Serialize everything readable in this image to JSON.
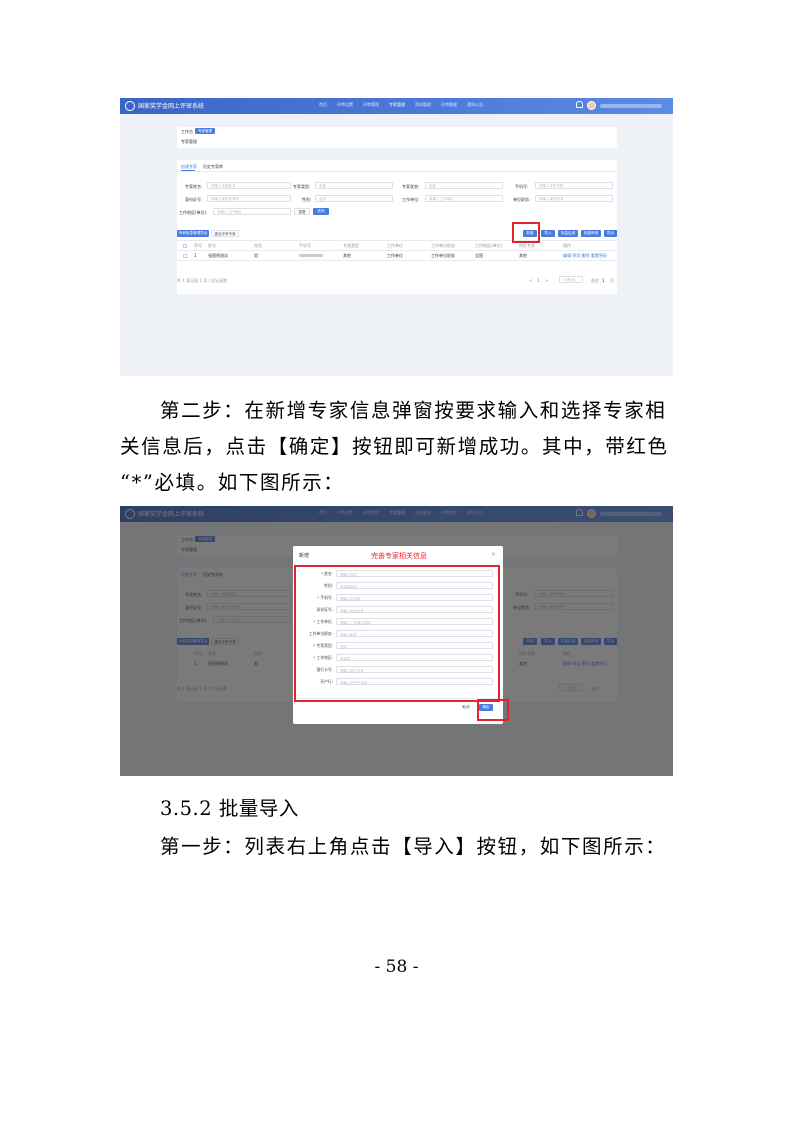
{
  "system_name": "国家奖学金网上评审系统",
  "nav_items": [
    "首页",
    "评审设置",
    "评审管理",
    "专家管理",
    "资料管理",
    "评审数据",
    "通知公告"
  ],
  "shot1": {
    "crumb_home": "工作台",
    "crumb_tag": "专家管理",
    "page_title": "专家管理",
    "tabs": [
      "创建专家",
      "历史专家库"
    ],
    "filters": [
      {
        "label": "专家姓名:",
        "placeholder": "请输入专家姓名"
      },
      {
        "label": "专家类型:",
        "placeholder": "全部"
      },
      {
        "label": "专家状态:",
        "placeholder": "全部"
      },
      {
        "label": "手机号:",
        "placeholder": "请输入手机号码"
      },
      {
        "label": "身份证号:",
        "placeholder": "请输入身份证号码"
      },
      {
        "label": "性别:",
        "placeholder": "全部"
      },
      {
        "label": "工作单位:",
        "placeholder": "请输入工作单位"
      },
      {
        "label": "单位职务:",
        "placeholder": "请输入单位职务"
      },
      {
        "label": "工作地区(单位):",
        "placeholder": "请输入工作地区"
      }
    ],
    "reset_label": "重置",
    "search_label": "查询",
    "left_buttons": [
      "专家信息管理导出",
      "重设评审专家"
    ],
    "right_buttons": [
      "新增",
      "导入",
      "批量启用",
      "批量停用",
      "导出"
    ],
    "columns": [
      "序号",
      "姓名",
      "性别",
      "手机号",
      "专家类型",
      "工作单位",
      "工作单位职务",
      "工作地区(单位)",
      "所在专家",
      "操作"
    ],
    "row": [
      "1",
      "张国明测试",
      "男",
      "",
      "其他",
      "工作单位",
      "工作单位职务",
      "全国",
      "其他",
      "编辑  停用  删除  重置密码"
    ],
    "footer_left": "共 1 条记录 1 页 / 总记录数",
    "pagination": [
      "<",
      "1",
      ">",
      "10条/页",
      "前往",
      "1",
      "页"
    ]
  },
  "step2_lines": [
    "第二步：在新增专家信息弹窗按要求输入和选择专家相",
    "关信息后，点击【确定】按钮即可新增成功。其中，带红色",
    "“*”必填。如下图所示："
  ],
  "shot2": {
    "modal_title": "新增",
    "modal_annotation": "完善专家相关信息",
    "close_label": "×",
    "fields": [
      {
        "label": "姓名:",
        "required": true,
        "placeholder": "请输入姓名"
      },
      {
        "label": "性别:",
        "required": false,
        "placeholder": "请选择性别"
      },
      {
        "label": "手机号:",
        "required": true,
        "placeholder": "请输入手机号"
      },
      {
        "label": "身份证号:",
        "required": false,
        "placeholder": "请输入身份证号"
      },
      {
        "label": "工作单位:",
        "required": true,
        "placeholder": "请输入工作单位名称"
      },
      {
        "label": "工作单位职务:",
        "required": false,
        "placeholder": "请输入职务"
      },
      {
        "label": "专家类型:",
        "required": true,
        "placeholder": "全部"
      },
      {
        "label": "工作地区:",
        "required": true,
        "placeholder": "请选择"
      },
      {
        "label": "银行卡号:",
        "required": false,
        "placeholder": "请输入银行卡号"
      },
      {
        "label": "开户行:",
        "required": false,
        "placeholder": "请输入开户行名称"
      }
    ],
    "cancel_label": "取消",
    "confirm_label": "确定"
  },
  "section_heading": "3.5.2 批量导入",
  "step1_line": "第一步：列表右上角点击【导入】按钮，如下图所示：",
  "page_number": "- 58 -",
  "colors": {
    "nav_blue": "#3b64c8",
    "button_blue": "#4a7be0",
    "highlight_red": "#e0262b"
  }
}
